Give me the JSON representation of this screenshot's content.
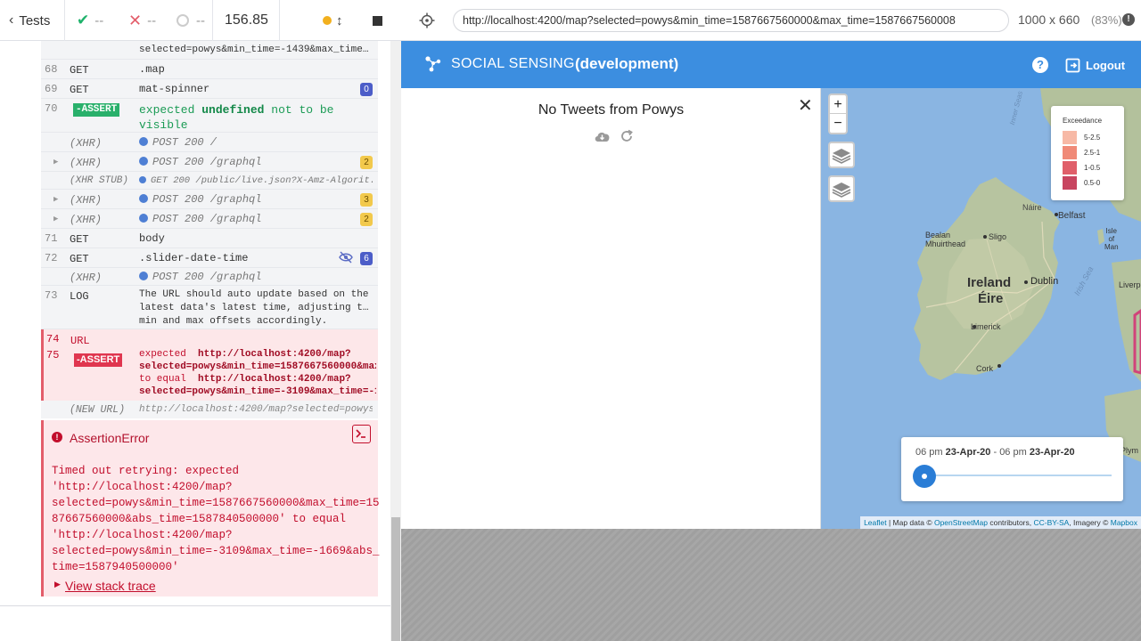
{
  "runner": {
    "tests_label": "Tests",
    "passed": "--",
    "failed": "--",
    "pending": "--",
    "duration": "156.85"
  },
  "log": {
    "truncated_top": "selected=powys&min_time=-1439&max_time=0&...",
    "rows": [
      {
        "num": "68",
        "cmd": "GET",
        "msg": ".map"
      },
      {
        "num": "69",
        "cmd": "GET",
        "msg": "mat-spinner",
        "badge": "0"
      },
      {
        "num": "70",
        "cmd": "-ASSERT",
        "msg_a": "expected",
        "msg_b": "undefined",
        "msg_c": "not to be",
        "msg_d": "visible"
      },
      {
        "xhr": "(XHR)",
        "msg": "POST 200 /"
      },
      {
        "xhr": "(XHR)",
        "msg": "POST 200 /graphql",
        "badge": "2"
      },
      {
        "xhr": "(XHR STUB)",
        "msg": "GET 200 /public/live.json?X-Amz-Algorit..."
      },
      {
        "xhr": "(XHR)",
        "msg": "POST 200 /graphql",
        "badge": "3"
      },
      {
        "xhr": "(XHR)",
        "msg": "POST 200 /graphql",
        "badge": "2"
      },
      {
        "num": "71",
        "cmd": "GET",
        "msg": "body"
      },
      {
        "num": "72",
        "cmd": "GET",
        "msg": ".slider-date-time",
        "badge": "6"
      },
      {
        "xhr": "(XHR)",
        "msg": "POST 200 /graphql"
      },
      {
        "num": "73",
        "cmd": "LOG",
        "msg_l1": "The URL should auto update based on the",
        "msg_l2": "latest data's latest time, adjusting the",
        "msg_l3": "min and max offsets accordingly."
      }
    ],
    "fail": {
      "num_a": "74",
      "cmd_a": "URL",
      "num_b": "75",
      "cmd_b": "-ASSERT",
      "l1a": "expected",
      "l1b": "http://localhost:4200/map?",
      "l2": "selected=powys&min_time=1587667560000&max…",
      "l3a": "to equal",
      "l3b": "http://localhost:4200/map?",
      "l4": "selected=powys&min_time=-3109&max_time=-1…"
    },
    "newurl": {
      "label": "(NEW URL)",
      "value": "http://localhost:4200/map?selected=powys&…"
    }
  },
  "error": {
    "title": "AssertionError",
    "body": "Timed out retrying: expected\n'http://localhost:4200/map?\nselected=powys&min_time=1587667560000&max_time=15\n87667560000&abs_time=1587840500000' to equal\n'http://localhost:4200/map?\nselected=powys&min_time=-3109&max_time=-1669&abs_\ntime=1587940500000'",
    "stack_label": "View stack trace"
  },
  "aut": {
    "url": "http://localhost:4200/map?selected=powys&min_time=1587667560000&max_time=1587667560008",
    "dimensions": "1000 x 660",
    "zoom": "(83%)"
  },
  "app": {
    "brand": "SOCIAL SENSING",
    "env": "(development)",
    "logout": "Logout",
    "panel_title": "No Tweets from Powys"
  },
  "map": {
    "legend_title": "Exceedance",
    "legend": [
      {
        "label": "5-2.5",
        "color": "#f7b9a6"
      },
      {
        "label": "2.5-1",
        "color": "#f08a78"
      },
      {
        "label": "1-0.5",
        "color": "#e05f6a"
      },
      {
        "label": "0.5-0",
        "color": "#c84560"
      }
    ],
    "labels": {
      "belfast": "Belfast",
      "ireland": "Ireland",
      "eire": "Éire",
      "dublin": "Dublin",
      "limerick": "Limerick",
      "cork": "Cork",
      "bealan": "Bealan",
      "mhuirthead": "Mhuirthead",
      "sligo": "Sligo",
      "isle": "Isle",
      "of": "of",
      "man": "Man",
      "irish_sea": "Irish Sea",
      "inner_sea": "Inner Seas",
      "liverp": "Liverp",
      "plym": "Plym",
      "naire": "Náire"
    },
    "slider": {
      "start_time": "06 pm",
      "start_date": "23-Apr-20",
      "dash": "-",
      "end_time": "06 pm",
      "end_date": "23-Apr-20",
      "value": 0
    },
    "attribution": {
      "leaflet": "Leaflet",
      "sep1": " | Map data © ",
      "osm": "OpenStreetMap",
      "sep2": " contributors, ",
      "cc": "CC-BY-SA",
      "sep3": ", Imagery © ",
      "mapbox": "Mapbox"
    },
    "zoom_in": "+",
    "zoom_out": "−"
  }
}
